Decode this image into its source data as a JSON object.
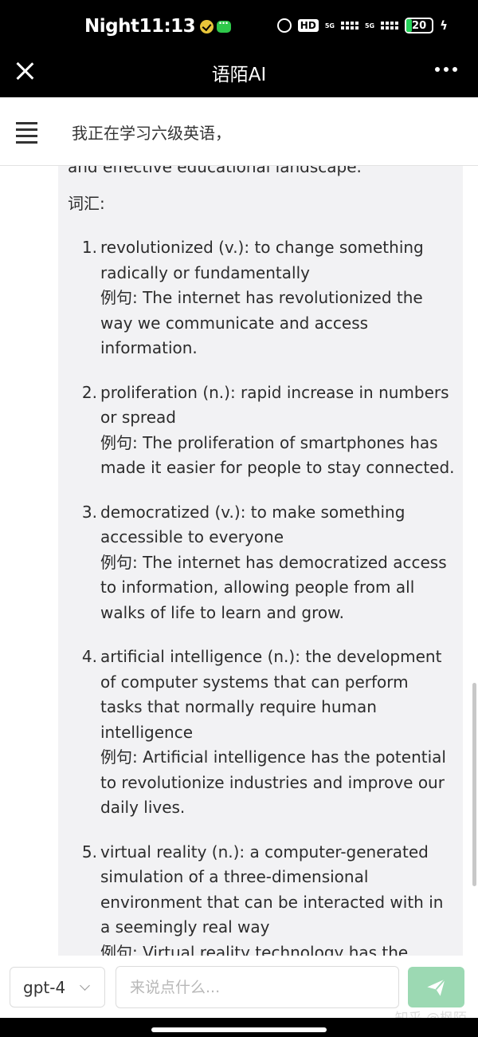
{
  "status_bar": {
    "time_text": "Night11:13",
    "hd_label": "HD",
    "signal_label_1": "5G",
    "signal_label_2": "5G",
    "battery_level": "20"
  },
  "header": {
    "title": "语陌AI"
  },
  "topic": {
    "text": "我正在学习六级英语，"
  },
  "message": {
    "lead_line": "and effective educational landscape.",
    "vocab_heading": "词汇:",
    "items": [
      {
        "num": "1.",
        "definition": "revolutionized (v.): to change something radically or fundamentally",
        "example": "例句: The internet has revolutionized the way we communicate and access information."
      },
      {
        "num": "2.",
        "definition": "proliferation (n.): rapid increase in numbers or spread",
        "example": "例句: The proliferation of smartphones has made it easier for people to stay connected."
      },
      {
        "num": "3.",
        "definition": "democratized (v.): to make something accessible to everyone",
        "example": "例句: The internet has democratized access to information, allowing people from all walks of life to learn and grow."
      },
      {
        "num": "4.",
        "definition": "artificial intelligence (n.): the development of computer systems that can perform tasks that normally require human intelligence",
        "example": "例句: Artificial intelligence has the potential to revolutionize industries and improve our daily lives."
      },
      {
        "num": "5.",
        "definition": "virtual reality (n.): a computer-generated simulation of a three-dimensional environment that can be interacted with in a seemingly real way",
        "example": "例句: Virtual reality technology has the potential to transform the way we learn and experience the world."
      }
    ]
  },
  "input_bar": {
    "model_value": "gpt-4",
    "placeholder": "来说点什么...",
    "watermark": "知乎 @枫陌"
  },
  "colors": {
    "send_button": "#9cd9b3",
    "bubble_bg": "#f2f2f4",
    "battery_fill": "#25d35a"
  }
}
